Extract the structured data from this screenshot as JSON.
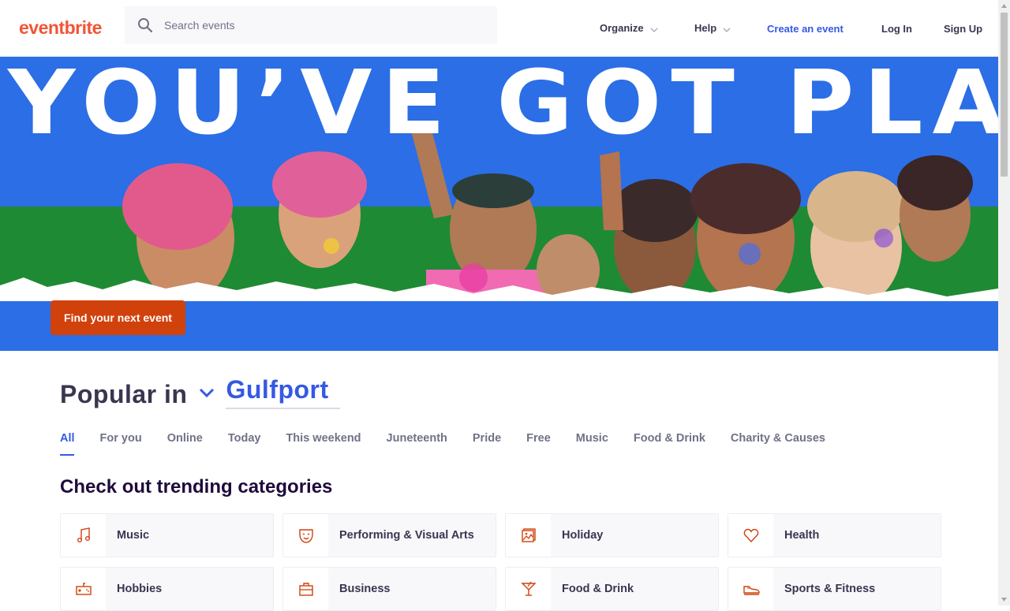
{
  "header": {
    "logo": "eventbrite",
    "search_placeholder": "Search events",
    "nav": {
      "organize": "Organize",
      "help": "Help",
      "create": "Create an event",
      "login": "Log In",
      "signup": "Sign Up"
    }
  },
  "hero": {
    "title": "YOU’VE GOT PLANS",
    "cta": "Find your next event",
    "colors": {
      "background": "#2b6ee6",
      "green_strip": "#1f8a34",
      "cta": "#d1410c"
    }
  },
  "popular": {
    "label": "Popular in",
    "location": "Gulfport"
  },
  "tabs": [
    "All",
    "For you",
    "Online",
    "Today",
    "This weekend",
    "Juneteenth",
    "Pride",
    "Free",
    "Music",
    "Food & Drink",
    "Charity & Causes"
  ],
  "active_tab": "All",
  "categories": {
    "title": "Check out trending categories",
    "items": [
      {
        "label": "Music",
        "icon": "music-note-icon"
      },
      {
        "label": "Performing & Visual Arts",
        "icon": "theater-mask-icon"
      },
      {
        "label": "Holiday",
        "icon": "holiday-picture-icon"
      },
      {
        "label": "Health",
        "icon": "heart-icon"
      },
      {
        "label": "Hobbies",
        "icon": "game-controller-icon"
      },
      {
        "label": "Business",
        "icon": "briefcase-icon"
      },
      {
        "label": "Food & Drink",
        "icon": "cocktail-icon"
      },
      {
        "label": "Sports & Fitness",
        "icon": "sneaker-icon"
      }
    ]
  },
  "colors": {
    "brand": "#f05537",
    "accent": "#3659e3",
    "icon": "#d1410c"
  }
}
